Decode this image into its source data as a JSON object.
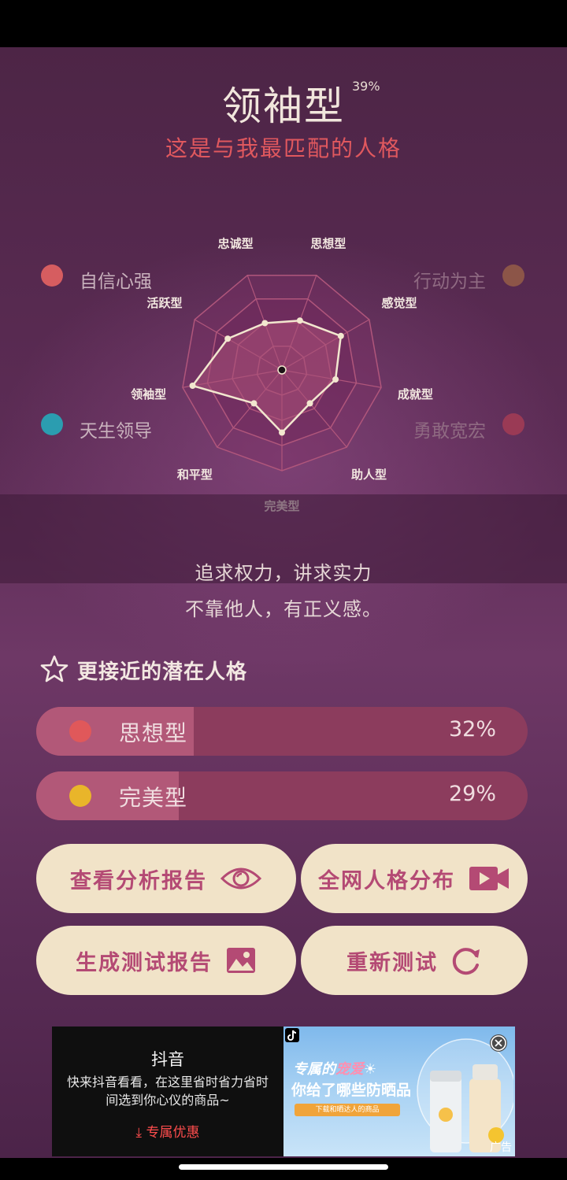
{
  "result": {
    "title": "领袖型",
    "percent": "39%",
    "subtitle": "这是与我最匹配的人格"
  },
  "traits": {
    "top_left": {
      "label": "自信心强",
      "color": "#d65d60"
    },
    "top_right": {
      "label": "行动为主",
      "color": "#8c5548"
    },
    "bottom_left": {
      "label": "天生领导",
      "color": "#2b9db0"
    },
    "bottom_right": {
      "label": "勇敢宽宏",
      "color": "#9a3a55"
    }
  },
  "chart_data": {
    "type": "radar",
    "axes": [
      "思想型",
      "感觉型",
      "成就型",
      "助人型",
      "完美型",
      "和平型",
      "领袖型",
      "活跃型",
      "忠诚型"
    ],
    "values": [
      0.58,
      0.75,
      0.6,
      0.48,
      0.69,
      0.48,
      1.0,
      0.69,
      0.55
    ],
    "range": [
      0,
      1
    ],
    "rings": 4,
    "colors": {
      "fill": "#9b4a70",
      "line": "#f2e7cf",
      "grid": "#b0567b"
    }
  },
  "description": {
    "line1": "追求权力，讲求实力",
    "line2": "不靠他人，有正义感。"
  },
  "latent": {
    "heading": "更接近的潜在人格",
    "items": [
      {
        "label": "思想型",
        "value": "32%",
        "fraction": 0.32,
        "dot_color": "#e0585a"
      },
      {
        "label": "完美型",
        "value": "29%",
        "fraction": 0.29,
        "dot_color": "#e9b52a"
      }
    ]
  },
  "buttons": {
    "view_report": "查看分析报告",
    "distribution": "全网人格分布",
    "generate_report": "生成测试报告",
    "retest": "重新测试"
  },
  "ad": {
    "brand": "抖音",
    "desc_line1": "快来抖音看看，在这里省时省力省时",
    "desc_line2": "间选到你心仪的商品~",
    "cta": "专属优惠",
    "headline_pre": "专属的",
    "headline_hl": "宠爱",
    "headline2": "你给了哪些防晒品",
    "pill": "下载和晒达人的商品",
    "tag": "广告"
  }
}
